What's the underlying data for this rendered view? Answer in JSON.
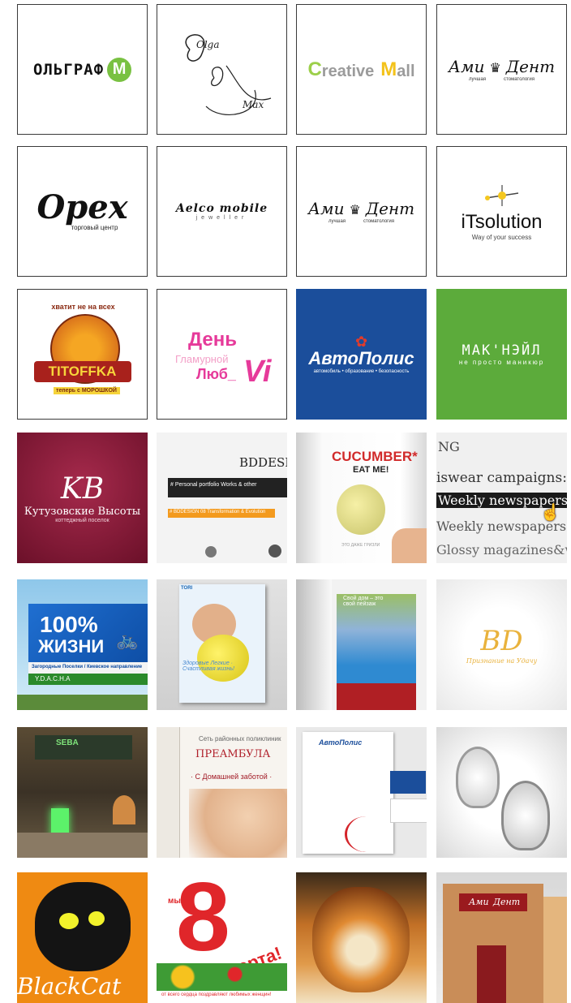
{
  "tiles": {
    "olgraf": {
      "text": "ОЛЬГРАФ",
      "mark": "M",
      "color": "#79c142"
    },
    "olga_max": {
      "line1": "Olga",
      "line2": "Max"
    },
    "creative_mall": {
      "text1": "reative",
      "text2": "all",
      "letter_c": "C",
      "letter_m": "M"
    },
    "ami_dent_1": {
      "name1": "Ами",
      "name2": "Дент",
      "sub1": "лучшая",
      "sub2": "стоматология"
    },
    "opex": {
      "title": "Opex",
      "sub": "торговый центр"
    },
    "aelco": {
      "title": "Aelco mobile",
      "sub": "jeweller"
    },
    "ami_dent_2": {
      "name1": "Ами",
      "name2": "Дент",
      "sub1": "лучшая",
      "sub2": "стоматология"
    },
    "itsolution": {
      "title": "iTsolution",
      "sub": "Way of your success"
    },
    "titoffka": {
      "arc": "хватит не на всех",
      "name": "TITOFFKA",
      "strip": "теперь с МОРОШКОЙ"
    },
    "den_glam": {
      "l1": "День",
      "l2": "Гламурной",
      "l3": "Люб_",
      "l4": "Vi"
    },
    "avtopolis": {
      "title": "АвтоПолис",
      "sub": "автомобиль • образование • безопасность",
      "bg": "#1b4e9b"
    },
    "maknail": {
      "title": "МАК'НЭЙЛ",
      "sub": "не просто маникюр",
      "bg": "#5cab3b"
    },
    "kutuzov": {
      "mono": "KB",
      "title": "Кутузовские Высоты",
      "sub": "коттеджный поселок",
      "bg": "#8e1b3a"
    },
    "bddesign": {
      "title": "BDDESIGN",
      "nav": "# Personal portfolio Works & other",
      "bar": "# BDDESIGN 08 Transformation & Evolution"
    },
    "cucumber": {
      "title": "CUCUMBER*",
      "sub": "EAT ME!",
      "caption": "ЭТО ДАЖЕ ГРИЗЛИ"
    },
    "newspapers": {
      "l0": "NG",
      "l1": "iswear campaigns:",
      "l2": "Weekly newspapers",
      "l3": "Weekly newspapers",
      "l4": "Glossy magazines&w"
    },
    "billboard": {
      "big": "100%",
      "big2": "ЖИЗНИ",
      "road": "Загородные Поселки / Киевское направление",
      "brand": "Y.D.A.C.H.A"
    },
    "tori": {
      "brand": "TORI",
      "text": "Здоровые Легкие · Счастливая жизнь!"
    },
    "doors": {
      "text": "Свой дом – это свой пейзаж"
    },
    "bd_mono": {
      "mono": "BD",
      "sub": "Признание на Удачу"
    },
    "sbera": {
      "text": "SEBA"
    },
    "preambula": {
      "top": "Сеть районных поликлиник",
      "name": "ПРЕАМБУЛА",
      "slogan": "· С Домашней заботой ·"
    },
    "stationery": {
      "brand": "АвтоПолис"
    },
    "jewelry": {
      "alt": ""
    },
    "cat": {
      "text": "BlackCat"
    },
    "march8": {
      "num": "8",
      "word": "марта!",
      "pre": "мы",
      "foot": "от всего сердца поздравляют любимых женщин!"
    },
    "tiger": {
      "alt": ""
    },
    "store": {
      "sign1": "Ами",
      "sign2": "Дент"
    }
  }
}
